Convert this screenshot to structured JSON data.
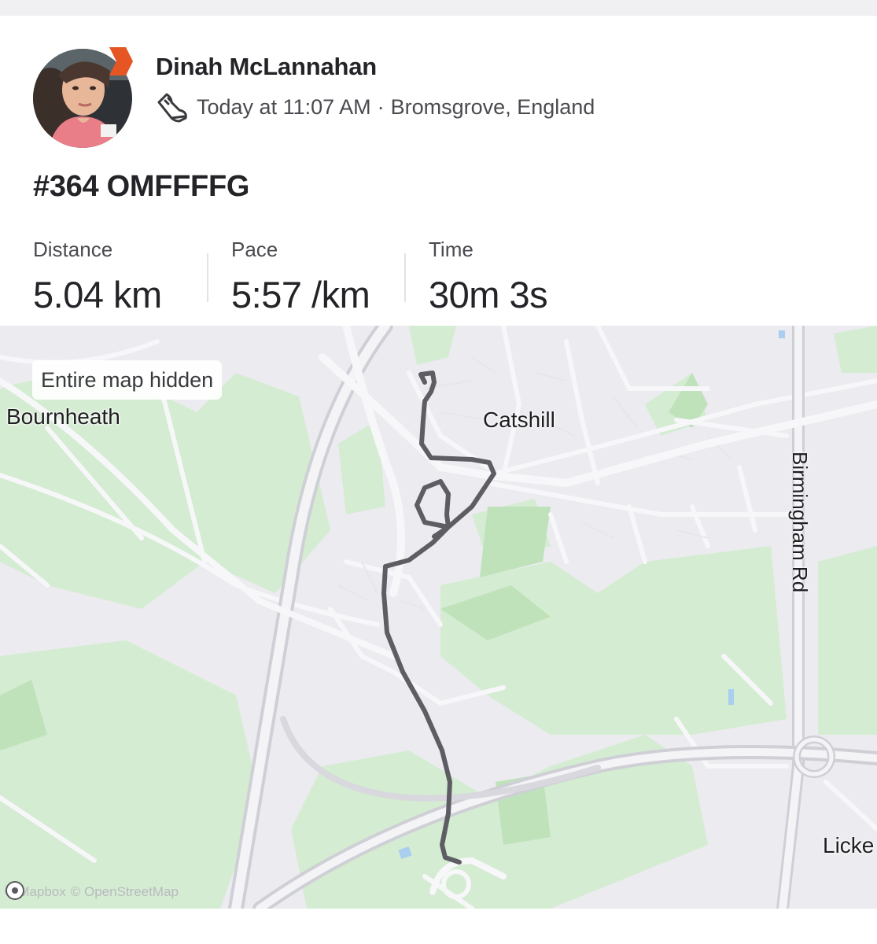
{
  "athlete": {
    "name": "Dinah McLannahan",
    "badge_color": "#e65524"
  },
  "activity": {
    "timestamp": "Today at 11:07 AM",
    "separator": "·",
    "location": "Bromsgrove, England",
    "type_icon": "run-shoe-icon",
    "title": "#364 OMFFFFG"
  },
  "stats": [
    {
      "label": "Distance",
      "value": "5.04 km"
    },
    {
      "label": "Pace",
      "value": "5:57 /km"
    },
    {
      "label": "Time",
      "value": "30m 3s"
    }
  ],
  "map": {
    "privacy_chip": "Entire map hidden",
    "places": {
      "bournheath": "Bournheath",
      "catshill": "Catshill",
      "lickey": "Licke"
    },
    "road_label": "Birmingham Rd",
    "attribution": {
      "mapbox": "© Mapbox",
      "osm": "© OpenStreetMap"
    },
    "route_color": "#5d5d63",
    "park_color": "#cfe9cc"
  }
}
